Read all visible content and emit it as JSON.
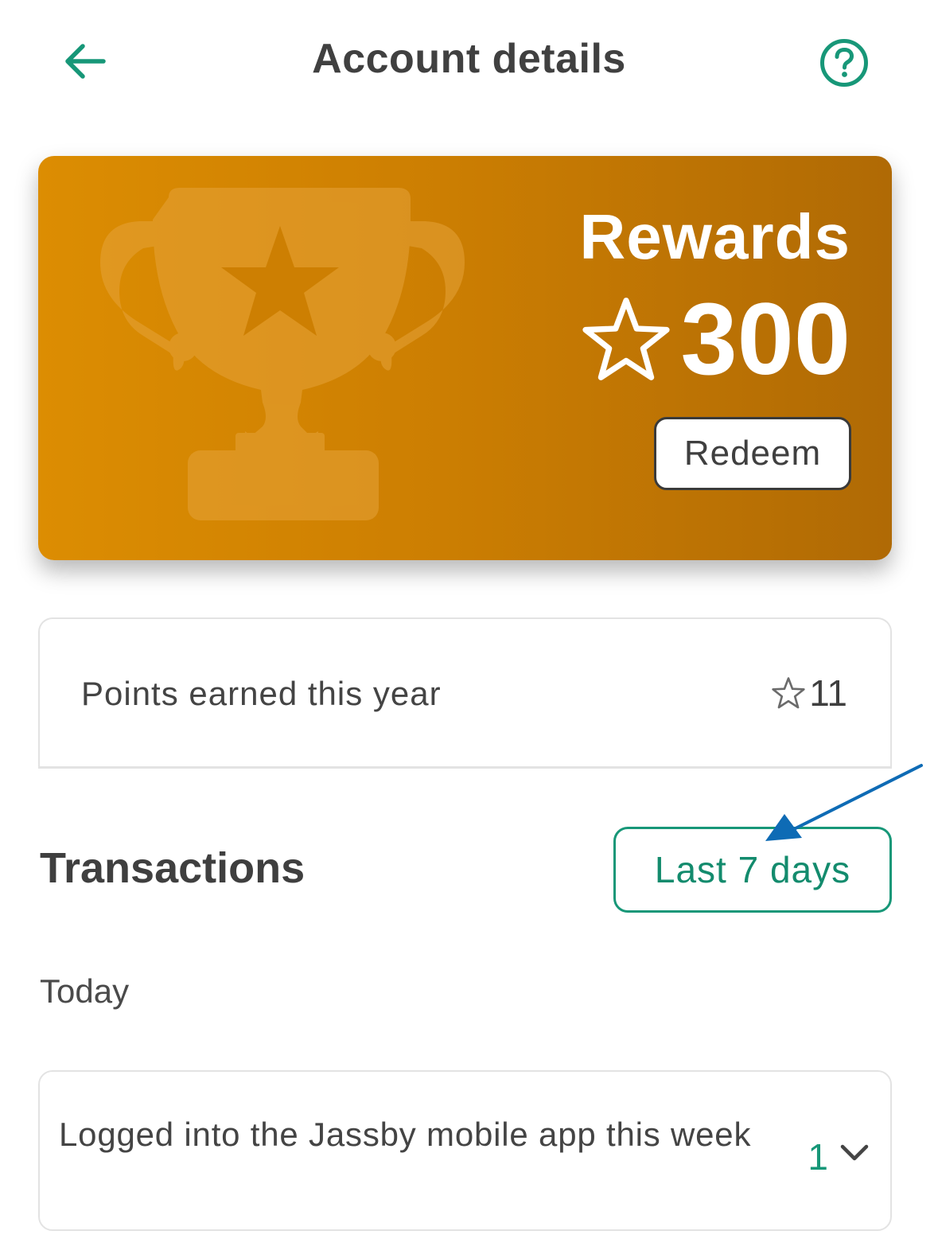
{
  "header": {
    "title": "Account details",
    "back_icon": "arrow-left-icon",
    "help_icon": "question-circle-icon",
    "accent_color": "#179778"
  },
  "rewards": {
    "title": "Rewards",
    "points": "300",
    "points_icon": "star-outline-icon",
    "redeem_label": "Redeem",
    "background_icon": "trophy-icon",
    "card_color": "#cd7f02"
  },
  "points_summary": {
    "label": "Points earned this year",
    "value": "11",
    "icon": "star-outline-icon"
  },
  "transactions": {
    "title": "Transactions",
    "filter_label": "Last 7 days",
    "annotation_color": "#0e6bb5",
    "groups": [
      {
        "label": "Today",
        "items": [
          {
            "description": "Logged into the Jassby mobile app this week",
            "points": "1"
          }
        ]
      }
    ]
  }
}
